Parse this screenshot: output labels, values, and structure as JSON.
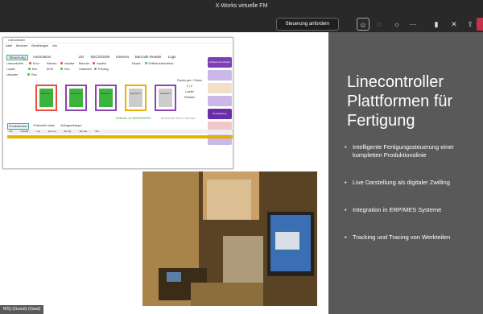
{
  "meeting": {
    "title": "X-Works virtuelle FM",
    "request_control_label": "Steuerung anfordern",
    "icons": [
      "people-icon",
      "chat-icon",
      "reactions-icon",
      "more-icon",
      "camera-icon",
      "mic-icon",
      "share-icon"
    ],
    "presenter_name": "MS] (Guest) (Gast)"
  },
  "app": {
    "window_title": "Linecontroller",
    "menu": [
      "Datei",
      "Benutzer",
      "Einstellungen",
      "Info"
    ],
    "tabs": [
      "Steuerung",
      "Automation",
      "LEI",
      "SECS/GEM",
      "Kamera",
      "Barcode Reader",
      "Logs"
    ],
    "active_tab": "Steuerung",
    "status_left": {
      "labels": [
        "Linecontroller",
        "Loader",
        "Unloader"
      ],
      "values": [
        "Error",
        "Run",
        "Run"
      ]
    },
    "status_mid": {
      "labels": [
        "Kamera",
        "EDIS",
        "Barcode"
      ],
      "values": [
        "Inactive",
        "Run",
        "Inactive"
      ]
    },
    "status_mid2": {
      "labels": [
        "Barcode",
        "Urlaubsbit",
        ""
      ],
      "values": [
        "Inactive",
        "Pending",
        ""
      ]
    },
    "modus_label": "Modus",
    "modus_value": "EinBlat automatisch",
    "panel_label": "Panels ges. / Fehler",
    "panel_value": "0 / 0",
    "loader_label": "Loader",
    "unloader_label": "Entlader",
    "cards": [
      {
        "label": "Maschine 1",
        "border": "#e74c3c",
        "fill": "#3cb43c"
      },
      {
        "label": "Maschine 2",
        "border": "#8e44ad",
        "fill": "#3cb43c"
      },
      {
        "label": "Maschine 3",
        "border": "#8e44ad",
        "fill": "#3cb43c"
      },
      {
        "label": "Maschine 4",
        "border": "#e6b200",
        "fill": "#cccccc"
      },
      {
        "label": "Maschine 5",
        "border": "#8e44ad",
        "fill": "#cccccc"
      }
    ],
    "side_buttons": [
      {
        "label": "Aufträge Zum Rüsten",
        "color": "#7b3fb8"
      },
      {
        "label": "",
        "color": "#c9b8e8"
      },
      {
        "label": "",
        "color": "#f4dfc8"
      },
      {
        "label": "",
        "color": "#c9b8e8"
      },
      {
        "label": "Bereitstellung",
        "color": "#6a2fa8"
      },
      {
        "label": "",
        "color": "#f0c8c8"
      },
      {
        "label": "",
        "color": "#c9b8e8"
      }
    ],
    "info_green": "ErNester. Id: 600000000007",
    "info_grey": "Beobachte Ohnen Operator",
    "subtabs": [
      "Produktionsliste",
      "Produzierte Lasten",
      "Auftragsanfrangen"
    ],
    "table_headers": [
      "Job",
      "Variable",
      "Los",
      "Ein Los",
      "Bel Typ",
      "Ein stat",
      "Info"
    ],
    "row_color": "#e6b200"
  },
  "slide": {
    "title": "Linecontroller Plattformen für Fertigung",
    "bullets": [
      "Intelligente Fertigungssteuerung einer kompletten Produktionslinie",
      "Live Darstellung als digitaler Zwilling",
      "Integration in ERP/MES Systeme",
      "Tracking und Tracing von Werkteilen"
    ]
  }
}
